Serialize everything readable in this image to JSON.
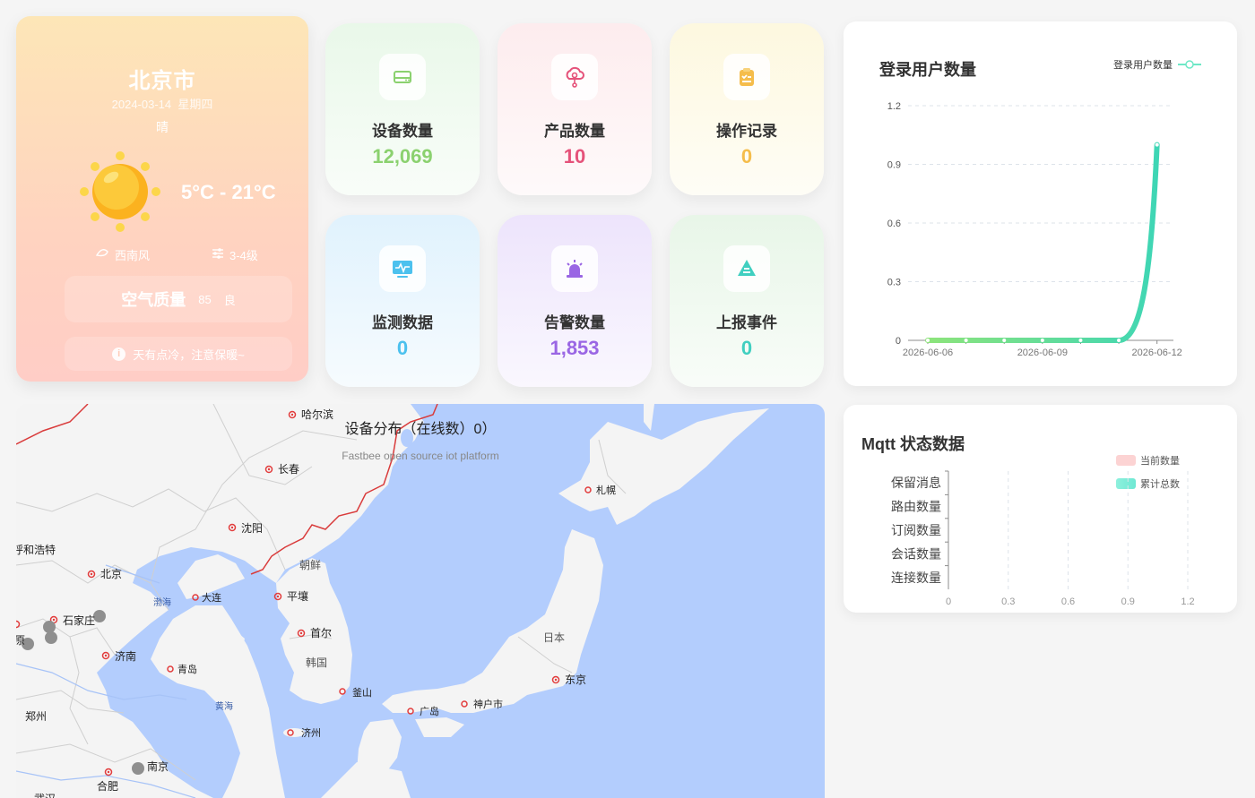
{
  "weather": {
    "city": "北京市",
    "date": "2024-03-14",
    "weekday": "星期四",
    "condition": "晴",
    "temp_range": "5°C - 21°C",
    "wind_dir": "西南风",
    "wind_level": "3-4级",
    "aqi_label": "空气质量",
    "aqi_value": "85",
    "aqi_grade": "良",
    "tip": "天有点冷，注意保暖~",
    "icons": {
      "sun": "sun-icon",
      "wind": "wind-icon",
      "level": "wind-level-icon",
      "tip": "info-icon"
    }
  },
  "stats": [
    {
      "label": "设备数量",
      "value": "12,069",
      "color": "#8bd16f",
      "bg": "#e9f8e9",
      "icon": "device-icon"
    },
    {
      "label": "产品数量",
      "value": "10",
      "color": "#e5527a",
      "bg": "#fdecee",
      "icon": "product-icon"
    },
    {
      "label": "操作记录",
      "value": "0",
      "color": "#f5bd4b",
      "bg": "#fdf8df",
      "icon": "clipboard-icon"
    },
    {
      "label": "监测数据",
      "value": "0",
      "color": "#4cc1ee",
      "bg": "#e0f2fd",
      "icon": "monitor-icon"
    },
    {
      "label": "告警数量",
      "value": "1,853",
      "color": "#9a66e4",
      "bg": "#ede4fc",
      "icon": "alarm-icon"
    },
    {
      "label": "上报事件",
      "value": "0",
      "color": "#40cfc0",
      "bg": "#e8f6e8",
      "icon": "report-icon"
    }
  ],
  "login_chart": {
    "title": "登录用户数量",
    "legend": "登录用户数量",
    "chart_data": {
      "type": "line",
      "x": [
        "2026-06-06",
        "2026-06-07",
        "2026-06-08",
        "2026-06-09",
        "2026-06-10",
        "2026-06-11",
        "2026-06-12"
      ],
      "xticks": [
        "2026-06-06",
        "2026-06-09",
        "2026-06-12"
      ],
      "series": [
        {
          "name": "登录用户数量",
          "values": [
            0,
            0,
            0,
            0,
            0,
            0,
            1
          ]
        }
      ],
      "yticks": [
        "0",
        "0.3",
        "0.6",
        "0.9",
        "1.2"
      ],
      "ylim": [
        0,
        1.2
      ],
      "colors": [
        "#8de47b",
        "#3ed6b5"
      ]
    }
  },
  "map": {
    "title": "设备分布（在线数）0）",
    "subtitle": "Fastbee open source iot platform",
    "labels": {
      "harbin": "哈尔滨",
      "changchun": "长春",
      "shenyang": "沈阳",
      "hohhot": "呼和浩特",
      "beijing": "北京",
      "dalian": "大连",
      "bohai": "渤海",
      "shijiazhuang": "石家庄",
      "taiyuan": "原",
      "jinan": "济南",
      "qingdao": "青岛",
      "yellowsea": "黄海",
      "zhengzhou": "郑州",
      "nanjing": "南京",
      "hefei": "合肥",
      "korea_n": "朝鲜",
      "pyongyang": "平壤",
      "seoul": "首尔",
      "korea_s": "韩国",
      "busan": "釜山",
      "jeju": "济州",
      "japan": "日本",
      "tokyo": "东京",
      "kobe": "神户市",
      "hiroshima": "广岛",
      "sapporo": "札幌",
      "wuhan": "武汉"
    }
  },
  "mqtt": {
    "title": "Mqtt 状态数据",
    "legend": [
      "当前数量",
      "累计总数"
    ],
    "chart_data": {
      "type": "bar",
      "categories": [
        "保留消息",
        "路由数量",
        "订阅数量",
        "会话数量",
        "连接数量"
      ],
      "series": [
        {
          "name": "当前数量",
          "values": [
            0,
            0,
            0,
            0,
            0
          ]
        },
        {
          "name": "累计总数",
          "values": [
            0,
            0,
            0,
            0,
            0
          ]
        }
      ],
      "xticks": [
        "0",
        "0.3",
        "0.6",
        "0.9",
        "1.2"
      ],
      "xlim": [
        0,
        1.2
      ],
      "colors": [
        "#fcd3d3",
        "#6ee8d3"
      ]
    }
  }
}
